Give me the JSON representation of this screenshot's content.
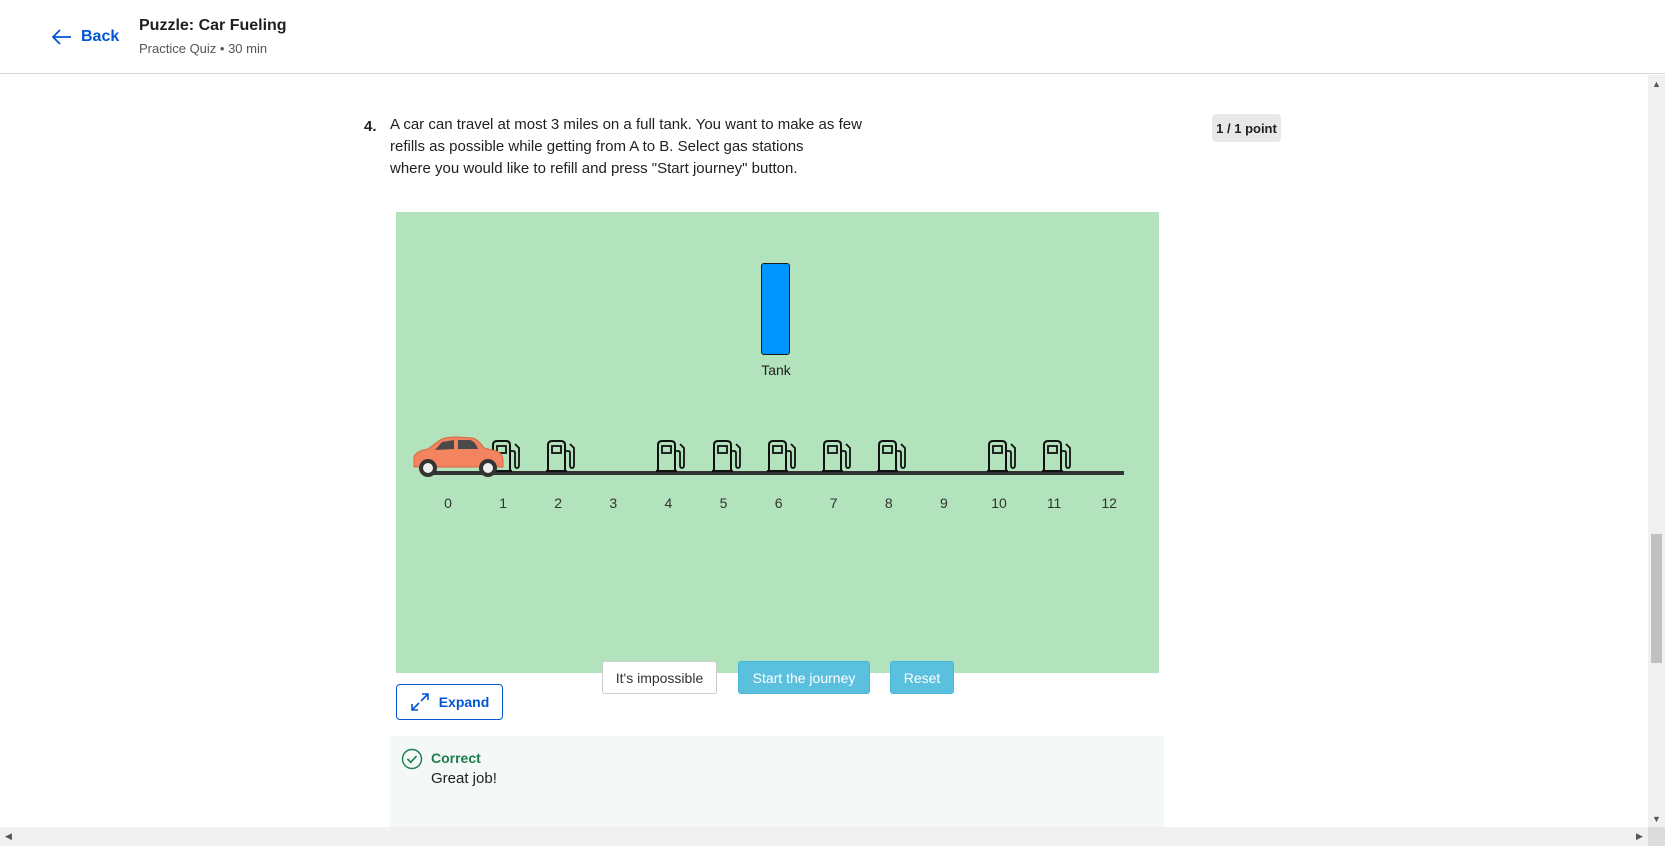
{
  "header": {
    "back_label": "Back",
    "title": "Puzzle: Car Fueling",
    "subtitle": "Practice Quiz • 30 min"
  },
  "question": {
    "number": "4.",
    "text": "A car can travel at most 3 miles on a full tank. You want to make as few\n refills as possible while getting from A to B. Select gas stations\nwhere you would like to refill and press \"Start journey\" button.",
    "points": "1 / 1 point"
  },
  "puzzle": {
    "tank_label": "Tank",
    "tank_level": 1.0,
    "tank_color": "#0094ff",
    "background_color": "#b2e3bc",
    "car_color": "#f4845f",
    "road_ticks": [
      "0",
      "1",
      "2",
      "3",
      "4",
      "5",
      "6",
      "7",
      "8",
      "9",
      "10",
      "11",
      "12"
    ],
    "station_positions": [
      1,
      2,
      4,
      5,
      6,
      7,
      8,
      10,
      11
    ],
    "car_position": 0,
    "buttons": {
      "impossible": "It's impossible",
      "start": "Start the journey",
      "reset": "Reset"
    }
  },
  "expand_label": "Expand",
  "feedback": {
    "status": "Correct",
    "message": "Great job!",
    "color": "#1d7c50"
  },
  "scrollbar": {
    "up": "▲",
    "down": "▼",
    "left": "◀",
    "right": "▶"
  }
}
